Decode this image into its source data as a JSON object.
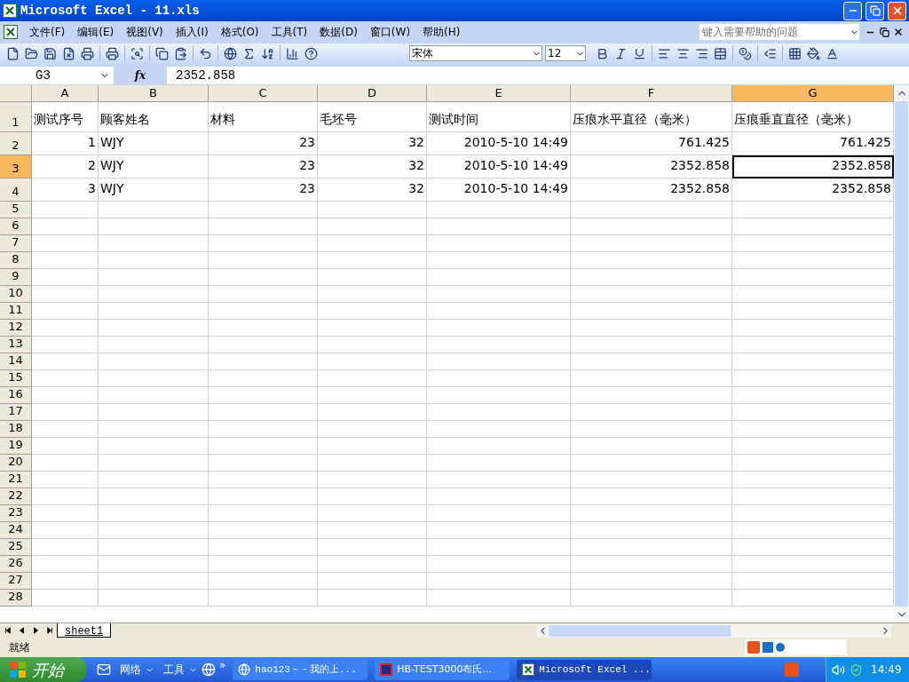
{
  "window": {
    "title": "Microsoft Excel - 11.xls"
  },
  "menu": [
    "文件(F)",
    "编辑(E)",
    "视图(V)",
    "插入(I)",
    "格式(O)",
    "工具(T)",
    "数据(D)",
    "窗口(W)",
    "帮助(H)"
  ],
  "help_box": {
    "placeholder": "键入需要帮助的问题"
  },
  "font_box": {
    "value": "宋体"
  },
  "size_box": {
    "value": "12"
  },
  "name_box": {
    "value": "G3"
  },
  "formula": {
    "label": "fx",
    "value": "2352.858"
  },
  "columns": [
    {
      "label": "A",
      "selected": false
    },
    {
      "label": "B",
      "selected": false
    },
    {
      "label": "C",
      "selected": false
    },
    {
      "label": "D",
      "selected": false
    },
    {
      "label": "E",
      "selected": false
    },
    {
      "label": "F",
      "selected": false
    },
    {
      "label": "G",
      "selected": true
    }
  ],
  "rows": [
    {
      "label": "1",
      "selected": false,
      "cells": [
        {
          "kind": "text",
          "value": "测试序号",
          "active": false
        },
        {
          "kind": "text",
          "value": "顾客姓名",
          "active": false
        },
        {
          "kind": "text",
          "value": "材料",
          "active": false
        },
        {
          "kind": "text",
          "value": "毛坯号",
          "active": false
        },
        {
          "kind": "text",
          "value": "测试时间",
          "active": false
        },
        {
          "kind": "text",
          "value": "压痕水平直径（毫米）",
          "active": false
        },
        {
          "kind": "text",
          "value": "压痕垂直直径（毫米）",
          "active": false
        }
      ]
    },
    {
      "label": "2",
      "selected": false,
      "cells": [
        {
          "kind": "number",
          "value": "1",
          "active": false
        },
        {
          "kind": "text",
          "value": "WJY",
          "active": false
        },
        {
          "kind": "number",
          "value": "23",
          "active": false
        },
        {
          "kind": "number",
          "value": "32",
          "active": false
        },
        {
          "kind": "number",
          "value": "2010-5-10 14:49",
          "active": false
        },
        {
          "kind": "number",
          "value": "761.425",
          "active": false
        },
        {
          "kind": "number",
          "value": "761.425",
          "active": false
        }
      ]
    },
    {
      "label": "3",
      "selected": true,
      "cells": [
        {
          "kind": "number",
          "value": "2",
          "active": false
        },
        {
          "kind": "text",
          "value": "WJY",
          "active": false
        },
        {
          "kind": "number",
          "value": "23",
          "active": false
        },
        {
          "kind": "number",
          "value": "32",
          "active": false
        },
        {
          "kind": "number",
          "value": "2010-5-10 14:49",
          "active": false
        },
        {
          "kind": "number",
          "value": "2352.858",
          "active": false
        },
        {
          "kind": "number",
          "value": "2352.858",
          "active": true
        }
      ]
    },
    {
      "label": "4",
      "selected": false,
      "cells": [
        {
          "kind": "number",
          "value": "3",
          "active": false
        },
        {
          "kind": "text",
          "value": "WJY",
          "active": false
        },
        {
          "kind": "number",
          "value": "23",
          "active": false
        },
        {
          "kind": "number",
          "value": "32",
          "active": false
        },
        {
          "kind": "number",
          "value": "2010-5-10 14:49",
          "active": false
        },
        {
          "kind": "number",
          "value": "2352.858",
          "active": false
        },
        {
          "kind": "number",
          "value": "2352.858",
          "active": false
        }
      ]
    },
    {
      "label": "5",
      "selected": false
    },
    {
      "label": "6",
      "selected": false
    },
    {
      "label": "7",
      "selected": false
    },
    {
      "label": "8",
      "selected": false
    },
    {
      "label": "9",
      "selected": false
    },
    {
      "label": "10",
      "selected": false
    },
    {
      "label": "11",
      "selected": false
    },
    {
      "label": "12",
      "selected": false
    },
    {
      "label": "13",
      "selected": false
    },
    {
      "label": "14",
      "selected": false
    },
    {
      "label": "15",
      "selected": false
    },
    {
      "label": "16",
      "selected": false
    },
    {
      "label": "17",
      "selected": false
    },
    {
      "label": "18",
      "selected": false
    },
    {
      "label": "19",
      "selected": false
    },
    {
      "label": "20",
      "selected": false
    },
    {
      "label": "21",
      "selected": false
    },
    {
      "label": "22",
      "selected": false
    },
    {
      "label": "23",
      "selected": false
    },
    {
      "label": "24",
      "selected": false
    },
    {
      "label": "25",
      "selected": false
    },
    {
      "label": "26",
      "selected": false
    },
    {
      "label": "27",
      "selected": false
    },
    {
      "label": "28",
      "selected": false
    }
  ],
  "sheet_tabs": [
    {
      "label": "sheet1",
      "selected": true
    }
  ],
  "status_bar": {
    "text": "就绪"
  },
  "taskbar": {
    "start": "开始",
    "quick_launch": [
      "网络",
      "工具"
    ],
    "more": "»",
    "tasks": [
      {
        "label": "hao123－－我的上...",
        "selected": false,
        "kind": "browser"
      },
      {
        "label": "HB-TEST3000布氏...",
        "selected": false,
        "kind": "app"
      },
      {
        "label": "Microsoft Excel ...",
        "selected": true,
        "kind": "excel"
      }
    ],
    "clock": "14:49"
  }
}
